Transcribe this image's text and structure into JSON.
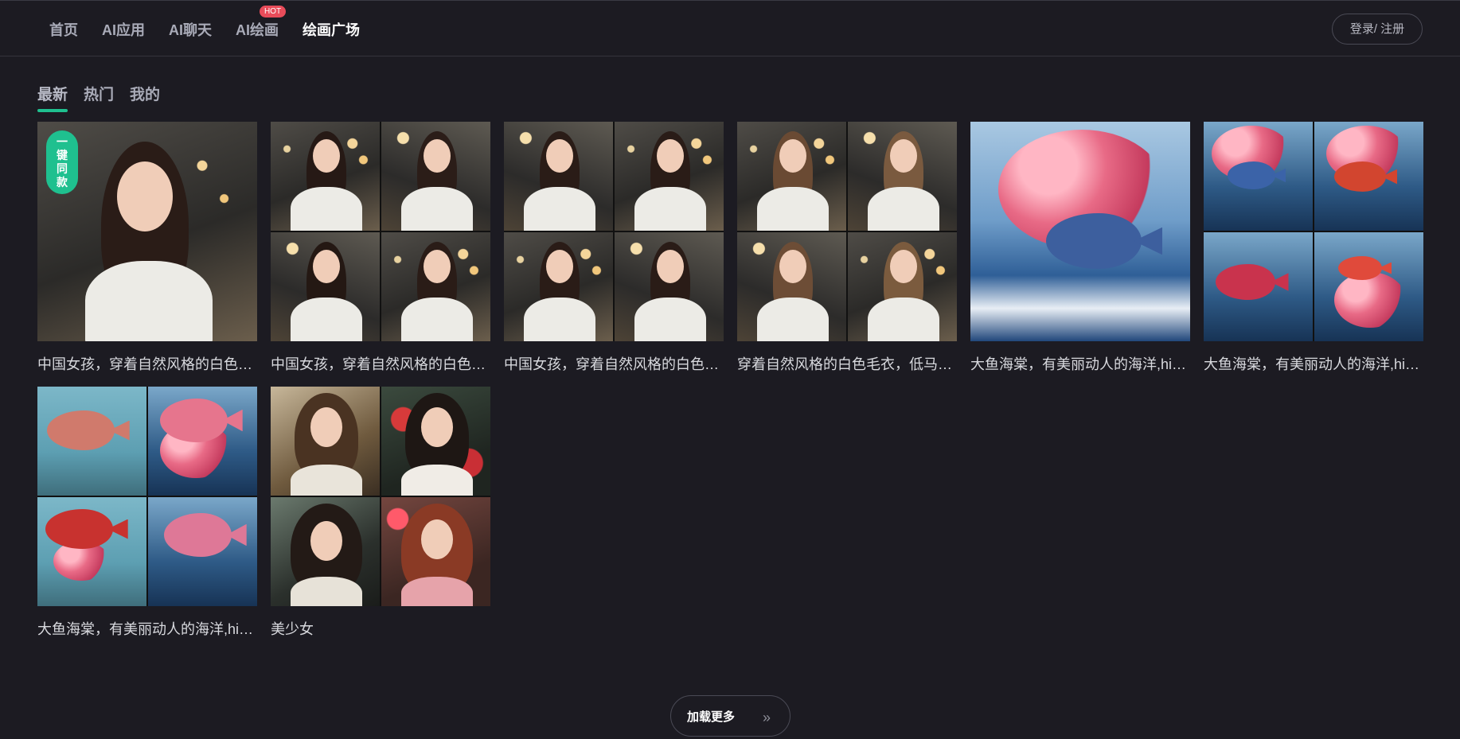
{
  "header": {
    "nav": [
      {
        "label": "首页",
        "active": false
      },
      {
        "label": "AI应用",
        "active": false
      },
      {
        "label": "AI聊天",
        "active": false
      },
      {
        "label": "AI绘画",
        "active": false,
        "badge": "HOT"
      },
      {
        "label": "绘画广场",
        "active": true
      }
    ],
    "login_label": "登录/ 注册"
  },
  "tabs": [
    {
      "label": "最新",
      "active": true
    },
    {
      "label": "热门",
      "active": false
    },
    {
      "label": "我的",
      "active": false
    }
  ],
  "gallery": {
    "overlay_label": [
      "一",
      "键",
      "同",
      "款"
    ],
    "items": [
      {
        "caption": "中国女孩，穿着自然风格的白色毛..."
      },
      {
        "caption": "中国女孩，穿着自然风格的白色毛..."
      },
      {
        "caption": "中国女孩，穿着自然风格的白色毛..."
      },
      {
        "caption": "穿着自然风格的白色毛衣，低马尾..."
      },
      {
        "caption": "大鱼海棠，有美丽动人的海洋,hig..."
      },
      {
        "caption": "大鱼海棠，有美丽动人的海洋,hig..."
      },
      {
        "caption": "大鱼海棠，有美丽动人的海洋,hig..."
      },
      {
        "caption": "美少女"
      }
    ]
  },
  "footer": {
    "load_more_label": "加载更多",
    "load_more_icon": "double-chevron-right-icon"
  }
}
